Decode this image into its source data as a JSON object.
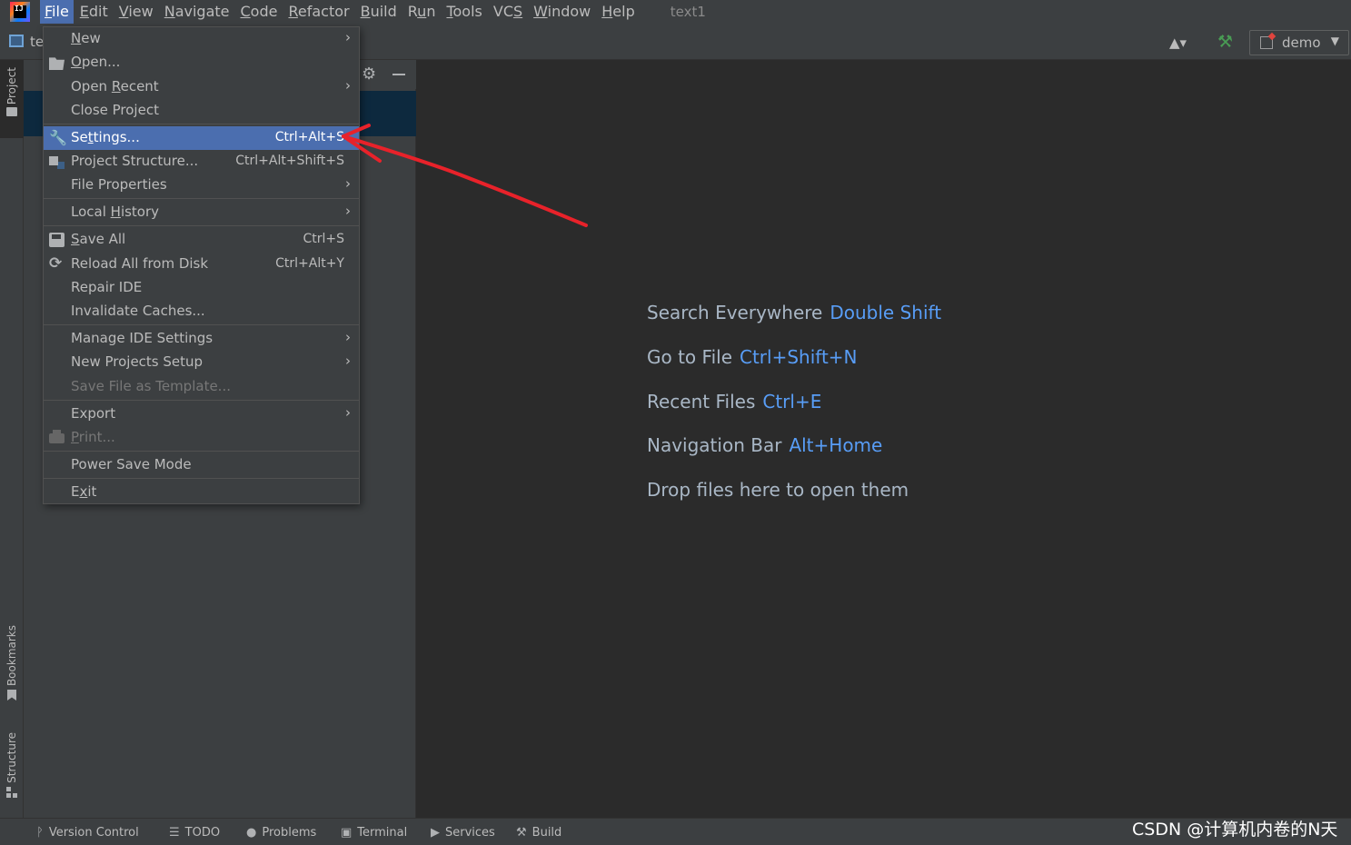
{
  "menubar": {
    "logo_text": "IJ",
    "items": [
      {
        "pre": "",
        "m": "F",
        "post": "ile"
      },
      {
        "pre": "",
        "m": "E",
        "post": "dit"
      },
      {
        "pre": "",
        "m": "V",
        "post": "iew"
      },
      {
        "pre": "",
        "m": "N",
        "post": "avigate"
      },
      {
        "pre": "",
        "m": "C",
        "post": "ode"
      },
      {
        "pre": "",
        "m": "R",
        "post": "efactor"
      },
      {
        "pre": "",
        "m": "B",
        "post": "uild"
      },
      {
        "pre": "R",
        "m": "u",
        "post": "n"
      },
      {
        "pre": "",
        "m": "T",
        "post": "ools"
      },
      {
        "pre": "VC",
        "m": "S",
        "post": ""
      },
      {
        "pre": "",
        "m": "W",
        "post": "indow"
      },
      {
        "pre": "",
        "m": "H",
        "post": "elp"
      }
    ],
    "title": "text1"
  },
  "toolbar": {
    "project_name": "te",
    "run_config": "demo",
    "user_icon": "▲▾",
    "build_icon": "⚒",
    "arrow": "▼"
  },
  "stripe": {
    "project": "Project",
    "bookmarks": "Bookmarks",
    "structure": "Structure"
  },
  "panel": {
    "gear": "⚙"
  },
  "file_menu": {
    "items": [
      {
        "pre": "",
        "m": "N",
        "post": "ew",
        "shortcut": "",
        "arrow": "›"
      },
      {
        "pre": "",
        "m": "O",
        "post": "pen...",
        "shortcut": "",
        "arrow": ""
      },
      {
        "pre": "Open ",
        "m": "R",
        "post": "ecent",
        "shortcut": "",
        "arrow": "›"
      },
      {
        "pre": "Close Project",
        "m": "",
        "post": "",
        "shortcut": "",
        "arrow": ""
      },
      {
        "pre": "Se",
        "m": "t",
        "post": "tings...",
        "shortcut": "Ctrl+Alt+S",
        "arrow": ""
      },
      {
        "pre": "Project Structure...",
        "m": "",
        "post": "",
        "shortcut": "Ctrl+Alt+Shift+S",
        "arrow": ""
      },
      {
        "pre": "File Properties",
        "m": "",
        "post": "",
        "shortcut": "",
        "arrow": "›"
      },
      {
        "pre": "Local ",
        "m": "H",
        "post": "istory",
        "shortcut": "",
        "arrow": "›"
      },
      {
        "pre": "",
        "m": "S",
        "post": "ave All",
        "shortcut": "Ctrl+S",
        "arrow": ""
      },
      {
        "pre": "Reload All from Disk",
        "m": "",
        "post": "",
        "shortcut": "Ctrl+Alt+Y",
        "arrow": ""
      },
      {
        "pre": "Repair IDE",
        "m": "",
        "post": "",
        "shortcut": "",
        "arrow": ""
      },
      {
        "pre": "Invalidate Caches...",
        "m": "",
        "post": "",
        "shortcut": "",
        "arrow": ""
      },
      {
        "pre": "Manage IDE Settings",
        "m": "",
        "post": "",
        "shortcut": "",
        "arrow": "›"
      },
      {
        "pre": "New Projects Setup",
        "m": "",
        "post": "",
        "shortcut": "",
        "arrow": "›"
      },
      {
        "pre": "Save File as Template...",
        "m": "",
        "post": "",
        "shortcut": "",
        "arrow": ""
      },
      {
        "pre": "Export",
        "m": "",
        "post": "",
        "shortcut": "",
        "arrow": "›"
      },
      {
        "pre": "",
        "m": "P",
        "post": "rint...",
        "shortcut": "",
        "arrow": ""
      },
      {
        "pre": "Power Save Mode",
        "m": "",
        "post": "",
        "shortcut": "",
        "arrow": ""
      },
      {
        "pre": "E",
        "m": "x",
        "post": "it",
        "shortcut": "",
        "arrow": ""
      }
    ]
  },
  "editor_hints": [
    {
      "label": "Search Everywhere",
      "key": "Double Shift"
    },
    {
      "label": "Go to File",
      "key": "Ctrl+Shift+N"
    },
    {
      "label": "Recent Files",
      "key": "Ctrl+E"
    },
    {
      "label": "Navigation Bar",
      "key": "Alt+Home"
    },
    {
      "label": "Drop files here to open them",
      "key": ""
    }
  ],
  "statusbar": {
    "items": [
      {
        "icon": "ᚹ",
        "label": "Version Control"
      },
      {
        "icon": "☰",
        "label": "TODO"
      },
      {
        "icon": "●",
        "label": "Problems"
      },
      {
        "icon": "▣",
        "label": "Terminal"
      },
      {
        "icon": "▶",
        "label": "Services"
      },
      {
        "icon": "⚒",
        "label": "Build"
      }
    ],
    "watermark": "CSDN @计算机内卷的N天"
  },
  "colors": {
    "selection": "#4b6eaf",
    "shortcut_blue": "#589df6",
    "annotation_red": "#e8222a"
  }
}
